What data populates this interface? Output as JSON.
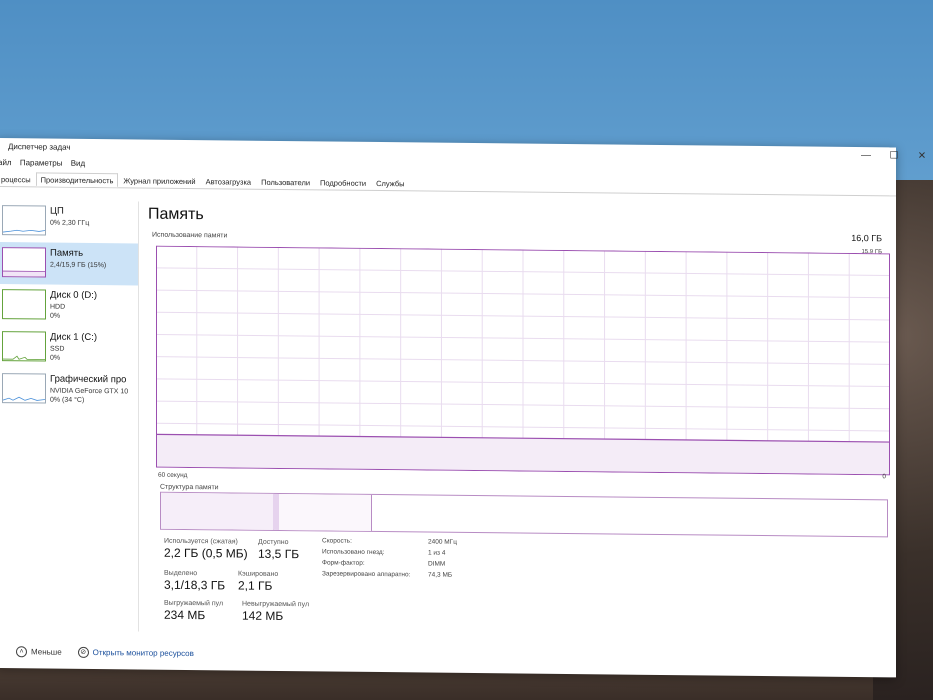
{
  "window": {
    "title": "Диспетчер задач"
  },
  "menu": [
    "айл",
    "Параметры",
    "Вид"
  ],
  "tabs": [
    "роцессы",
    "Производительность",
    "Журнал приложений",
    "Автозагрузка",
    "Пользователи",
    "Подробности",
    "Службы"
  ],
  "active_tab": "Производительность",
  "sidebar": [
    {
      "title": "ЦП",
      "lines": [
        "0% 2,30 ГГц"
      ]
    },
    {
      "title": "Память",
      "lines": [
        "2,4/15,9 ГБ (15%)"
      ]
    },
    {
      "title": "Диск 0 (D:)",
      "lines": [
        "HDD",
        "0%"
      ]
    },
    {
      "title": "Диск 1 (C:)",
      "lines": [
        "SSD",
        "0%"
      ]
    },
    {
      "title": "Графический про",
      "lines": [
        "NVIDIA GeForce GTX 10",
        "0% (34 °C)"
      ]
    }
  ],
  "main": {
    "title": "Память",
    "capacity": "16,0 ГБ",
    "graph_label": "Использование памяти",
    "graph_max": "15,9 ГБ",
    "graph_left": "60 секунд",
    "graph_right": "0",
    "usage_fraction": 0.15,
    "structure_label": "Структура памяти",
    "stats": {
      "in_use_label": "Используется (сжатая)",
      "in_use": "2,2 ГБ (0,5 МБ)",
      "available_label": "Доступно",
      "available": "13,5 ГБ",
      "committed_label": "Выделено",
      "committed": "3,1/18,3 ГБ",
      "cached_label": "Кэшировано",
      "cached": "2,1 ГБ",
      "paged_label": "Выгружаемый пул",
      "paged": "234 МБ",
      "nonpaged_label": "Невыгружаемый пул",
      "nonpaged": "142 МБ"
    },
    "details": [
      {
        "k": "Скорость:",
        "v": "2400 МГц"
      },
      {
        "k": "Использовано гнезд:",
        "v": "1 из 4"
      },
      {
        "k": "Форм-фактор:",
        "v": "DIMM"
      },
      {
        "k": "Зарезервировано аппаратно:",
        "v": "74,3 МБ"
      }
    ]
  },
  "footer": {
    "less": "Меньше",
    "monitor": "Открыть монитор ресурсов"
  },
  "colors": {
    "memory": "#9b4fb0",
    "grid": "#e9dcef",
    "selection": "#cce3f7",
    "disk": "#64a33c"
  }
}
